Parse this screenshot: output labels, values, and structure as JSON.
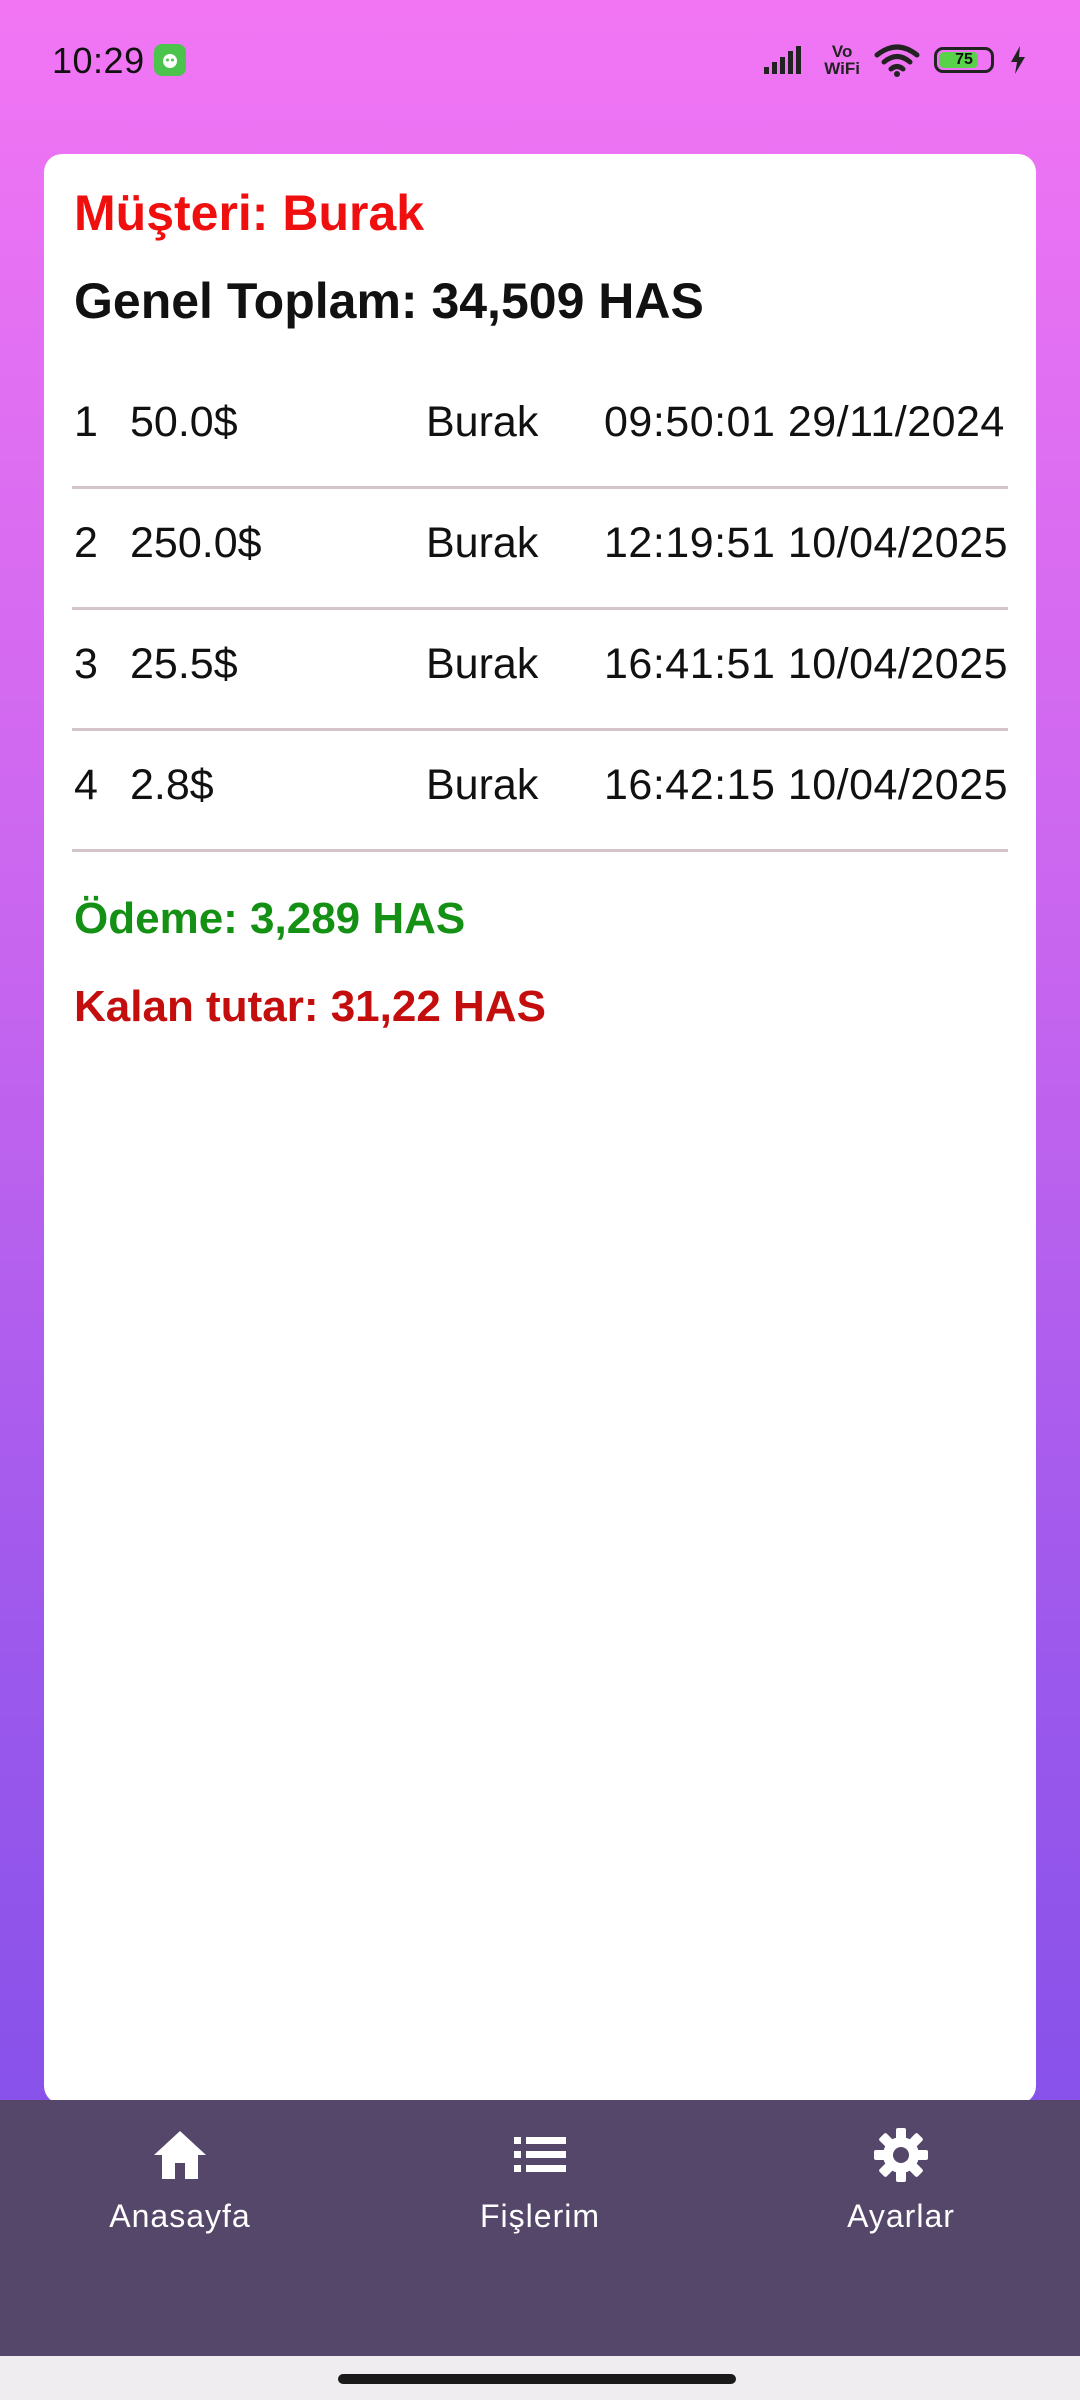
{
  "status_bar": {
    "time": "10:29",
    "network_label_top": "Vo",
    "network_label_bottom": "WiFi",
    "battery_level": "75"
  },
  "card": {
    "customer_title": "Müşteri: Burak",
    "grand_total": "Genel Toplam: 34,509 HAS",
    "rows": [
      {
        "index": "1",
        "amount": "50.0$",
        "name": "Burak",
        "datetime": "09:50:01 29/11/2024"
      },
      {
        "index": "2",
        "amount": "250.0$",
        "name": "Burak",
        "datetime": "12:19:51 10/04/2025"
      },
      {
        "index": "3",
        "amount": "25.5$",
        "name": "Burak",
        "datetime": "16:41:51 10/04/2025"
      },
      {
        "index": "4",
        "amount": "2.8$",
        "name": "Burak",
        "datetime": "16:42:15 10/04/2025"
      }
    ],
    "payment": "Ödeme: 3,289 HAS",
    "remaining": "Kalan tutar: 31,22 HAS"
  },
  "bottom_nav": {
    "items": [
      {
        "label": "Anasayfa",
        "icon": "home-icon"
      },
      {
        "label": "Fişlerim",
        "icon": "list-icon"
      },
      {
        "label": "Ayarlar",
        "icon": "gear-icon"
      }
    ]
  },
  "colors": {
    "customer_title": "#f00f0f",
    "payment": "#149014",
    "remaining": "#c40e0e",
    "nav_background": "#55476a"
  }
}
